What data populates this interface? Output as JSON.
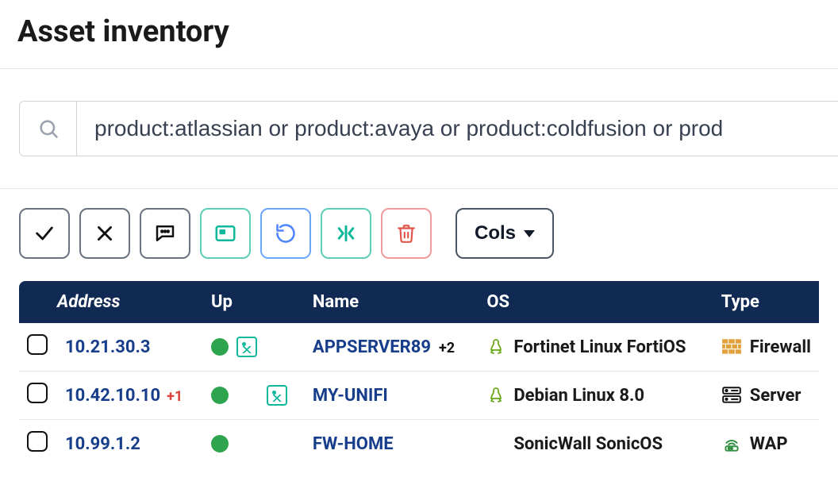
{
  "page": {
    "title": "Asset inventory"
  },
  "search": {
    "value": "product:atlassian or product:avaya or product:coldfusion or prod"
  },
  "toolbar": {
    "cols_label": "Cols"
  },
  "table": {
    "headers": {
      "address": "Address",
      "up": "Up",
      "name": "Name",
      "os": "OS",
      "type": "Type"
    },
    "rows": [
      {
        "address": "10.21.30.3",
        "address_extra": "",
        "up": true,
        "up_icons": [
          "image"
        ],
        "name": "APPSERVER89",
        "name_extra": "+2",
        "os_icon": "linux",
        "os": "Fortinet Linux FortiOS",
        "type_icon": "firewall",
        "type": "Firewall"
      },
      {
        "address": "10.42.10.10",
        "address_extra": "+1",
        "up": true,
        "up_icons": [
          "cloud",
          "image"
        ],
        "name": "MY-UNIFI",
        "name_extra": "",
        "os_icon": "linux",
        "os": "Debian Linux 8.0",
        "type_icon": "server",
        "type": "Server"
      },
      {
        "address": "10.99.1.2",
        "address_extra": "",
        "up": true,
        "up_icons": [],
        "name": "FW-HOME",
        "name_extra": "",
        "os_icon": "",
        "os": "SonicWall SonicOS",
        "type_icon": "wap",
        "type": "WAP"
      }
    ]
  }
}
